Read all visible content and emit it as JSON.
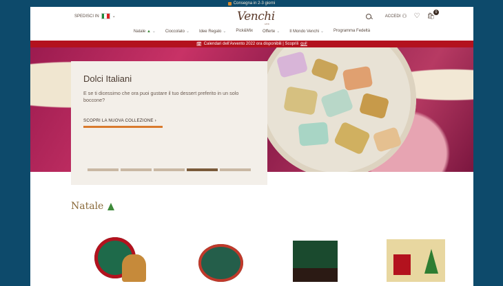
{
  "topbar": {
    "text": "Consegna in 2-3 giorni"
  },
  "header": {
    "ship_label": "SPEDISCI IN",
    "logo": "Venchi",
    "logo_sub": "1878",
    "login_label": "ACCEDI",
    "cart_count": "0"
  },
  "nav": {
    "items": [
      {
        "label": "Natale"
      },
      {
        "label": "Cioccolato"
      },
      {
        "label": "Idee Regalo"
      },
      {
        "label": "Pick&Mix"
      },
      {
        "label": "Offerte"
      },
      {
        "label": "Il Mondo Venchi"
      },
      {
        "label": "Programma Fedeltà"
      }
    ]
  },
  "promo": {
    "text": "Calendari dell'Avvento 2022 ora disponibili | Scoprili",
    "link": "qui!"
  },
  "hero": {
    "title": "Dolci Italiani",
    "text": "E se ti dicessimo che ora puoi gustare il tuo dessert preferito in un solo boccone?",
    "cta": "SCOPRI LA NUOVA COLLEZIONE",
    "slides": 5,
    "active_slide": 4
  },
  "section": {
    "title": "Natale"
  },
  "colors": {
    "accent": "#d97a2c",
    "promo_bg": "#b3121e",
    "frame_bg": "#0d4a6b"
  }
}
